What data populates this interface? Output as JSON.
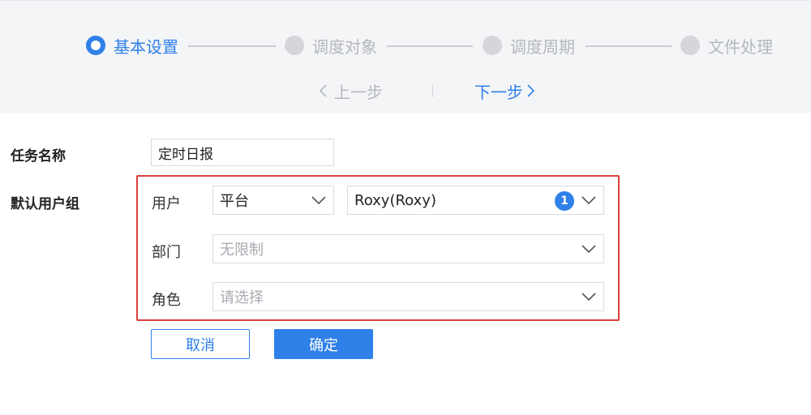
{
  "steps": [
    {
      "label": "基本设置",
      "active": true
    },
    {
      "label": "调度对象",
      "active": false
    },
    {
      "label": "调度周期",
      "active": false
    },
    {
      "label": "文件处理",
      "active": false
    }
  ],
  "nav": {
    "prev_label": "上一步",
    "next_label": "下一步"
  },
  "form": {
    "task_name_label": "任务名称",
    "task_name_value": "定时日报",
    "default_group_label": "默认用户组",
    "user_label": "用户",
    "user_type_value": "平台",
    "user_value": "Roxy(Roxy)",
    "user_count_badge": "1",
    "department_label": "部门",
    "department_value": "无限制",
    "role_label": "角色",
    "role_placeholder": "请选择"
  },
  "actions": {
    "cancel_label": "取消",
    "confirm_label": "确定"
  },
  "colors": {
    "accent": "#2f80e8",
    "highlight_border": "#d9403c",
    "panel_bg": "#f4f5f7"
  }
}
